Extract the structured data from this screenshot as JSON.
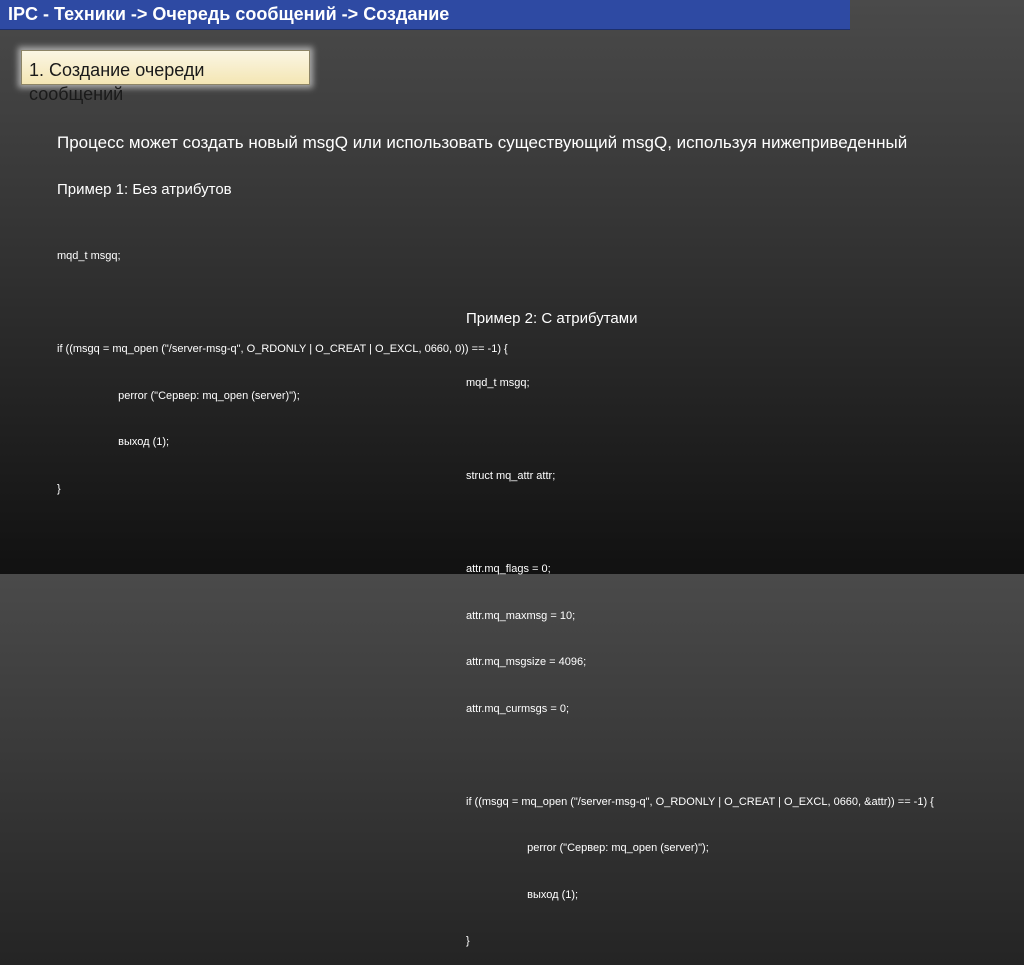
{
  "header": {
    "title": "IPC - Техники -> Очередь сообщений -> Создание"
  },
  "section": {
    "line1": "1. Создание очереди",
    "line2": "сообщений"
  },
  "intro": "Процесс может создать новый msgQ или использовать существующий msgQ, используя нижеприведенный",
  "example1": {
    "title": "Пример 1: Без атрибутов",
    "code": [
      "mqd_t msgq;",
      "",
      "if ((msgq = mq_open (\"/server-msg-q\", O_RDONLY | O_CREAT | O_EXCL, 0660, 0)) == -1) {",
      "                    perror (\"Сервер: mq_open (server)\");",
      "                    выход (1);",
      "}"
    ]
  },
  "example2": {
    "title": "Пример 2: С атрибутами",
    "code": [
      "mqd_t msgq;",
      "",
      "struct mq_attr attr;",
      "",
      "attr.mq_flags = 0;",
      "attr.mq_maxmsg = 10;",
      "attr.mq_msgsize = 4096;",
      "attr.mq_curmsgs = 0;",
      "",
      "if ((msgq = mq_open (\"/server-msg-q\", O_RDONLY | O_CREAT | O_EXCL, 0660, &attr)) == -1) {",
      "                    perror (\"Сервер: mq_open (server)\");",
      "                    выход (1);",
      "}"
    ]
  },
  "colors": {
    "title_bar": "#2e4aa3",
    "section_box": "#f4e6b4",
    "background_top": "#4a4a4a",
    "background_bottom": "#111111",
    "text": "#ffffff"
  }
}
